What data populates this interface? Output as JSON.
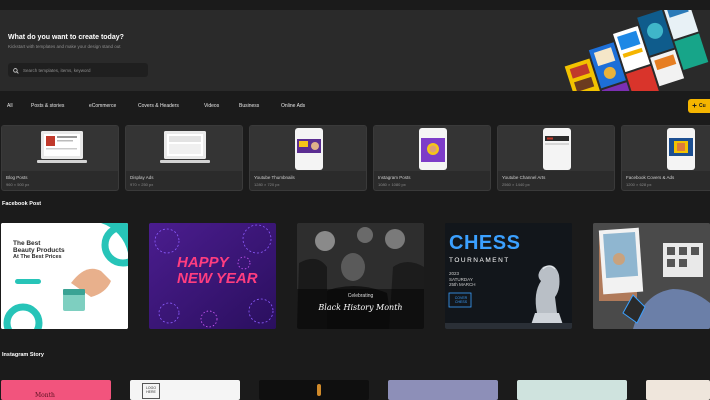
{
  "hero": {
    "title": "What do you want to create today?",
    "subtitle": "Kickstart with templates and make your design stand out",
    "search_placeholder": "Search templates, items, keyword"
  },
  "categories": [
    "All",
    "Posts & stories",
    "eCommerce",
    "Covers & Headers",
    "Videos",
    "Business",
    "Online Ads"
  ],
  "create_button": "Cu",
  "formats": [
    {
      "name": "Blog Posts",
      "size": "960 × 500 px"
    },
    {
      "name": "Display Ads",
      "size": "970 × 250 px"
    },
    {
      "name": "Youtube Thumbnails",
      "size": "1280 × 720 px"
    },
    {
      "name": "Instagram Posts",
      "size": "1080 × 1080 px"
    },
    {
      "name": "Youtube Channel Arts",
      "size": "2560 × 1440 px"
    },
    {
      "name": "Facebook Covers & Ads",
      "size": "1200 × 628 px"
    }
  ],
  "sections": {
    "facebook_post": "Facebook Post",
    "instagram_story": "Instagram Story"
  },
  "posts": {
    "beauty": {
      "line1": "The Best",
      "line2": "Beauty Products",
      "line3": "At The Best Prices"
    },
    "newyear": {
      "line1": "HAPPY",
      "line2": "NEW YEAR"
    },
    "mlk": {
      "small": "Celebrating",
      "script": "Black History Month"
    },
    "chess": {
      "title": "CHESS",
      "sub": "TOURNAMENT",
      "year": "2023",
      "day": "SATURDAY",
      "date": "25th MARCH",
      "badge": "COVER CHESS"
    }
  },
  "stories": {
    "story1_text": "Month",
    "story2_text": "LOGO HERE"
  },
  "colors": {
    "accent": "#f5b500",
    "background": "#1b1b1b",
    "panel": "#2a2a2a"
  }
}
